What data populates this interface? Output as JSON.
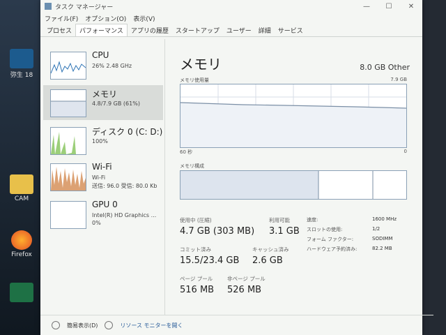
{
  "window": {
    "title": "タスク マネージャー"
  },
  "menu": [
    "ファイル(F)",
    "オプション(O)",
    "表示(V)"
  ],
  "tabs": [
    "プロセス",
    "パフォーマンス",
    "アプリの履歴",
    "スタートアップ",
    "ユーザー",
    "詳細",
    "サービス"
  ],
  "sidebar": [
    {
      "title": "CPU",
      "sub": "26%  2.48 GHz",
      "sub2": ""
    },
    {
      "title": "メモリ",
      "sub": "4.8/7.9 GB (61%)",
      "sub2": ""
    },
    {
      "title": "ディスク 0 (C: D:)",
      "sub": "100%",
      "sub2": ""
    },
    {
      "title": "Wi-Fi",
      "sub": "Wi-Fi",
      "sub2": "送信: 96.0  受信: 80.0 Kb"
    },
    {
      "title": "GPU 0",
      "sub": "Intel(R) HD Graphics ...",
      "sub2": "0%"
    }
  ],
  "main": {
    "title": "メモリ",
    "mem_type": "8.0 GB Other",
    "usage_label": "メモリ使用量",
    "usage_max": "7.9 GB",
    "time_left": "60 秒",
    "time_right": "0",
    "composition_label": "メモリ構成",
    "stats": {
      "in_use_label": "使用中 (圧縮)",
      "in_use": "4.7 GB (303 MB)",
      "available_label": "利用可能",
      "available": "3.1 GB",
      "committed_label": "コミット済み",
      "committed": "15.5/23.4 GB",
      "cached_label": "キャッシュ済み",
      "cached": "2.6 GB",
      "paged_label": "ページ プール",
      "paged": "516 MB",
      "nonpaged_label": "非ページ プール",
      "nonpaged": "526 MB"
    },
    "specs": [
      {
        "label": "速度:",
        "value": "1600 MHz"
      },
      {
        "label": "スロットの使用:",
        "value": "1/2"
      },
      {
        "label": "フォーム ファクター:",
        "value": "SODIMM"
      },
      {
        "label": "ハードウェア予約済み:",
        "value": "82.2 MB"
      }
    ]
  },
  "footer": {
    "brief": "簡易表示(D)",
    "monitor": "リソース モニターを開く"
  },
  "desktop": {
    "icon1": "弥生",
    "icon1b": "18",
    "icon2": "CAM",
    "icon3": "Firefox"
  },
  "colors": {
    "accent": "#8aa0b6",
    "memory_graph": "#7b8fa6",
    "selection": "#d9dcd9"
  }
}
